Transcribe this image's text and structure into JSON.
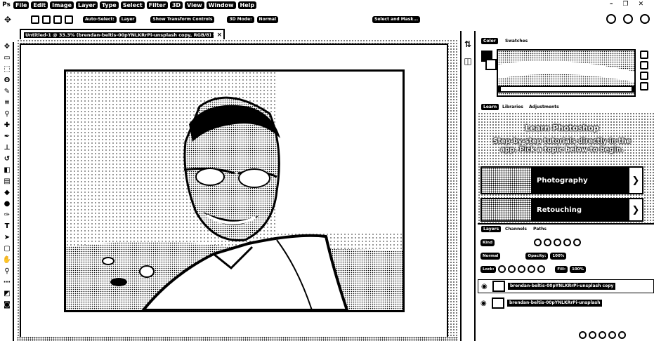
{
  "app": {
    "logo": "Ps"
  },
  "menubar": {
    "items": [
      "File",
      "Edit",
      "Image",
      "Layer",
      "Type",
      "Select",
      "Filter",
      "3D",
      "View",
      "Window",
      "Help"
    ]
  },
  "window_controls": {
    "minimize": "–",
    "restore": "❐",
    "close": "✕"
  },
  "options_bar": {
    "auto_select_label": "Auto-Select:",
    "auto_select_value": "Layer",
    "transform_label": "Show Transform Controls",
    "mode_label": "3D Mode:",
    "mode_value": "Normal",
    "select_subject_label": "Select and Mask..."
  },
  "document_tab": {
    "title": "Untitled-1 @ 33.3% (brendan-beltis-00pYNLKRrPi-unsplash copy, RGB/8) *",
    "close": "×"
  },
  "toolbar": {
    "icons": [
      "move-icon",
      "artboard-icon",
      "marquee-icon",
      "lasso-icon",
      "quick-select-icon",
      "crop-icon",
      "eyedropper-icon",
      "healing-icon",
      "brush-icon",
      "stamp-icon",
      "history-brush-icon",
      "eraser-icon",
      "gradient-icon",
      "blur-icon",
      "dodge-icon",
      "pen-icon",
      "type-icon",
      "path-select-icon",
      "shape-icon",
      "hand-icon",
      "zoom-icon",
      "more-icon",
      "color-swatch-icon",
      "mask-icon"
    ]
  },
  "panel": {
    "color_tab": "Color",
    "swatches_tab": "Swatches",
    "learn_tab": "Learn",
    "libraries_tab": "Libraries",
    "adjustments_tab": "Adjustments",
    "learn_title": "Learn Photoshop",
    "learn_desc": "Step-by-step tutorials directly in the app. Pick a topic below to begin.",
    "cards": [
      {
        "label": "Photography",
        "arrow": "❯"
      },
      {
        "label": "Retouching",
        "arrow": "❯"
      }
    ]
  },
  "layers": {
    "tabs": [
      "Layers",
      "Channels",
      "Paths"
    ],
    "kind_label": "Kind",
    "blend_mode": "Normal",
    "opacity_label": "Opacity:",
    "opacity_value": "100%",
    "lock_label": "Lock:",
    "fill_label": "Fill:",
    "fill_value": "100%",
    "rows": [
      {
        "name": "brendan-beltis-00pYNLKRrPi-unsplash copy",
        "selected": true
      },
      {
        "name": "brendan-beltis-00pYNLKRrPi-unsplash",
        "selected": false
      }
    ]
  }
}
